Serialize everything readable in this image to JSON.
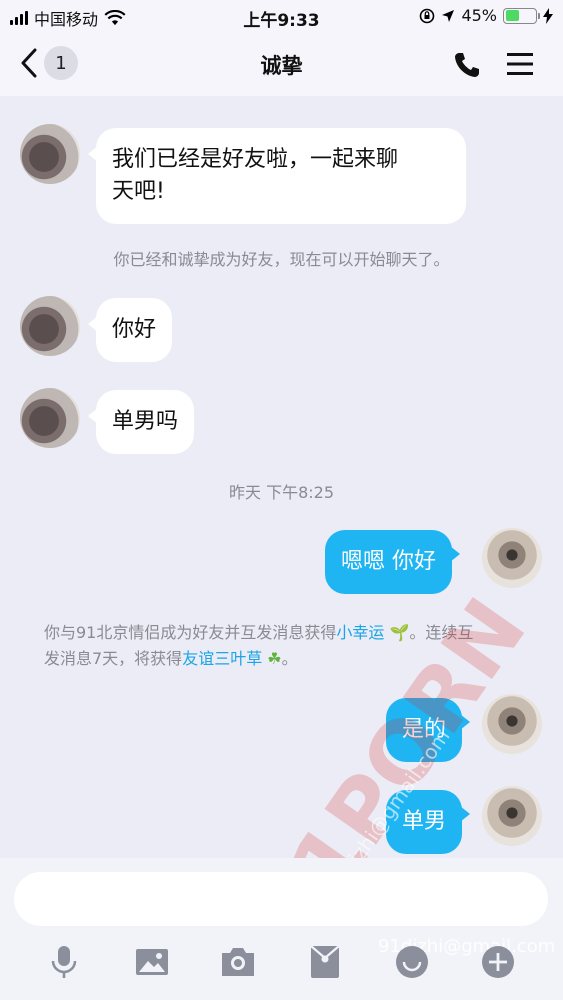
{
  "status_bar": {
    "carrier": "中国移动",
    "time": "上午9:33",
    "battery": "45%",
    "battery_level": 0.45,
    "battery_color": "#4cd964"
  },
  "nav": {
    "back_icon": "chevron-left-icon",
    "unread_count": "1",
    "title": "诚挚",
    "call_icon": "phone-icon",
    "menu_icon": "hamburger-menu-icon"
  },
  "messages": {
    "m1": "我们已经是好友啦，一起来聊天吧!",
    "m1_line1": "我们已经是好友啦，一起来聊",
    "m1_line2": "天吧!",
    "sys1": "你已经和诚挚成为好友，现在可以开始聊天了。",
    "m2": "你好",
    "m3": "单男吗",
    "timestamp": "昨天 下午8:25",
    "m4": "嗯嗯 你好",
    "sys2_part1": "你与91北京情侣成为好友并互发消息获得",
    "sys2_link1": "小幸运",
    "sys2_part2": "。连续互",
    "sys2_part3": "发消息7天，将获得",
    "sys2_link2": "友谊三叶草",
    "sys2_part4": "。",
    "m5": "是的",
    "m6": "单男"
  },
  "watermarks": {
    "big": "91PORN",
    "email_diag": "91dizhi@gmail.com",
    "email_bottom": "91dizhi@gmail.com"
  },
  "colors": {
    "sent_bubble": "#1fb4f2",
    "received_bubble": "#ffffff",
    "chat_bg": "#ebecf5",
    "link": "#1aa5e6"
  },
  "toolbar": {
    "icons": [
      "microphone-icon",
      "image-icon",
      "camera-icon",
      "red-packet-icon",
      "emoji-icon",
      "plus-icon"
    ]
  }
}
